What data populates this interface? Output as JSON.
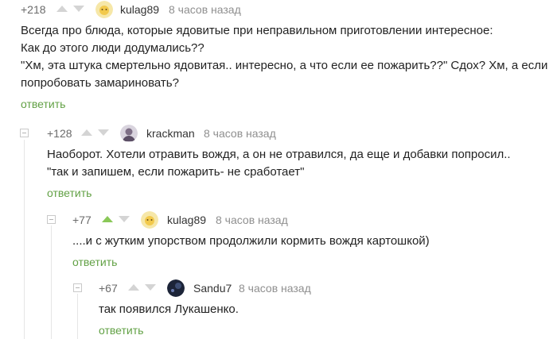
{
  "comments": [
    {
      "rating": "+218",
      "author": "kulag89",
      "time": "8 часов назад",
      "lines": [
        "Всегда про блюда, которые ядовитые при неправильном приготовлении интересное:",
        "Как до этого люди додумались??",
        "\"Хм, эта штука смертельно ядовитая.. интересно, а что если ее пожарить??\" Сдох? Хм, а если",
        "попробовать замариновать?"
      ],
      "reply": "ответить"
    },
    {
      "rating": "+128",
      "author": "krackman",
      "time": "8 часов назад",
      "lines": [
        "Наоборот. Хотели отравить вождя, а он не отравился, да еще и добавки попросил..",
        "\"так и запишем, если пожарить- не сработает\""
      ],
      "reply": "ответить"
    },
    {
      "rating": "+77",
      "author": "kulag89",
      "time": "8 часов назад",
      "lines": [
        "....и с жутким упорством продолжили кормить вождя картошкой)"
      ],
      "reply": "ответить"
    },
    {
      "rating": "+67",
      "author": "Sandu7",
      "time": "8 часов назад",
      "lines": [
        "так появился Лукашенко."
      ],
      "reply": "ответить"
    }
  ],
  "colors": {
    "upvote_active": "#8ac858",
    "reply_link": "#62a145"
  },
  "icons": {
    "collapse": "collapse-minus-icon",
    "upvote": "upvote-arrow-icon",
    "downvote": "downvote-arrow-icon"
  }
}
